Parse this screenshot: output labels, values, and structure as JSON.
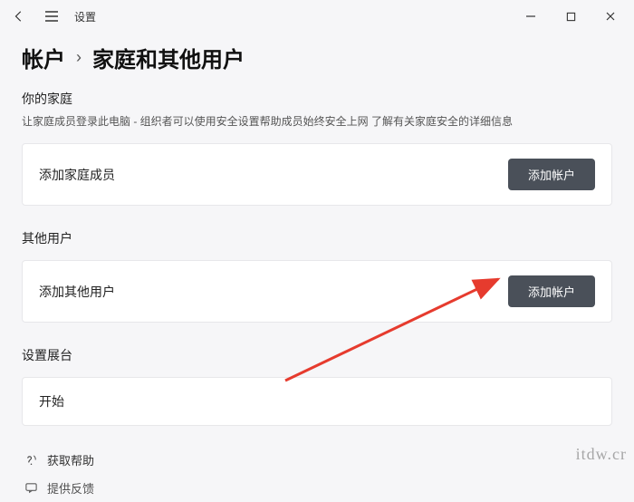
{
  "titlebar": {
    "app_name": "设置"
  },
  "breadcrumb": {
    "parent": "帐户",
    "separator": "›",
    "current": "家庭和其他用户"
  },
  "family": {
    "title": "你的家庭",
    "description_prefix": "让家庭成员登录此电脑 - 组织者可以使用安全设置帮助成员始终安全上网  ",
    "description_link": "了解有关家庭安全的详细信息",
    "card_label": "添加家庭成员",
    "button_label": "添加帐户"
  },
  "others": {
    "title": "其他用户",
    "card_label": "添加其他用户",
    "button_label": "添加帐户"
  },
  "kiosk": {
    "title": "设置展台",
    "card_label": "开始"
  },
  "footer": {
    "help": "获取帮助",
    "feedback": "提供反馈"
  },
  "watermark": "itdw.cr"
}
